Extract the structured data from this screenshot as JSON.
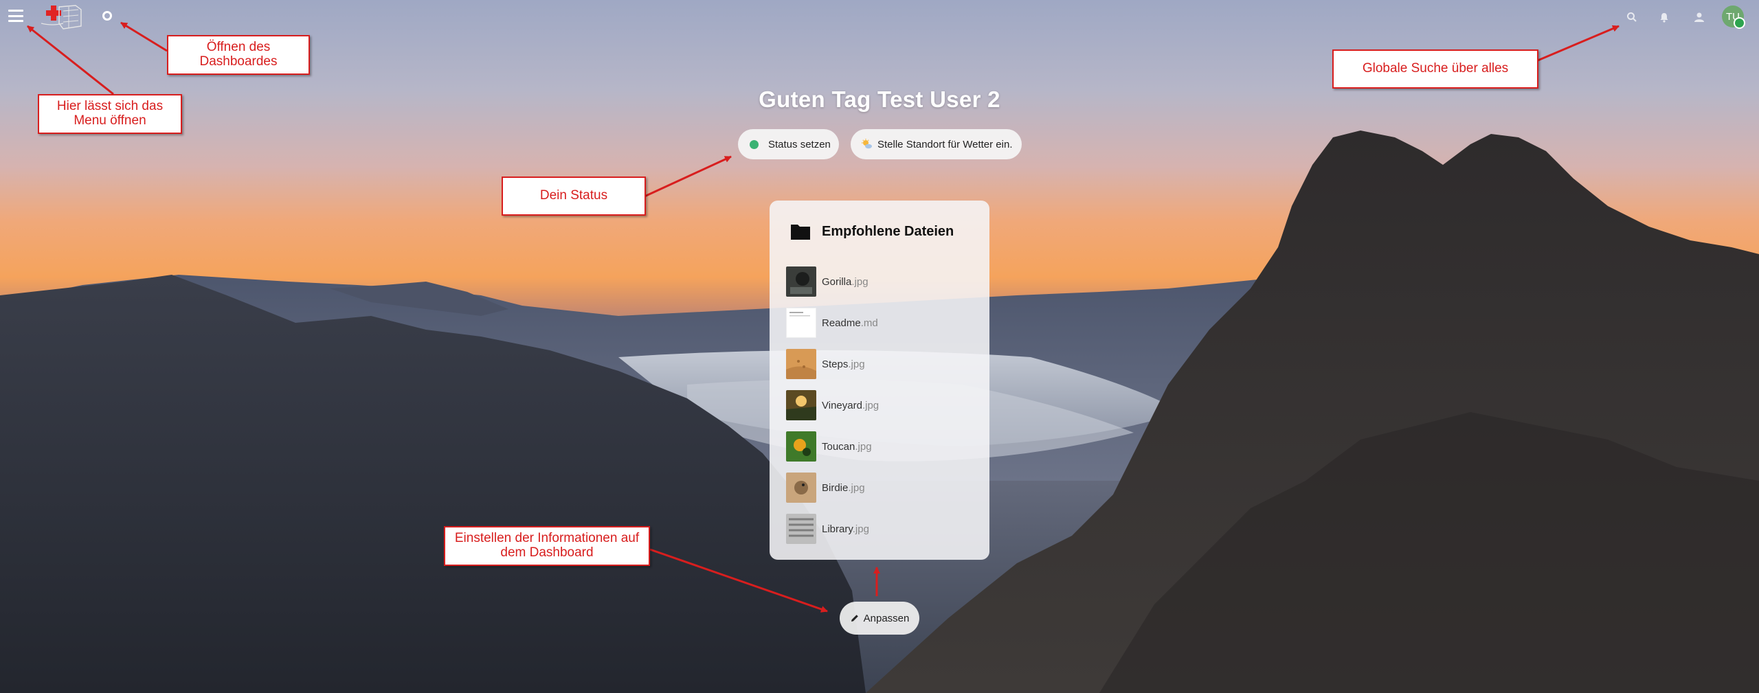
{
  "header": {
    "menu_icon": "hamburger-menu-icon",
    "logo_icon": "app-logo",
    "dashboard_icon": "dashboard-circle-icon",
    "search_icon": "search-icon",
    "notifications_icon": "bell-icon",
    "contacts_icon": "contacts-icon",
    "avatar_initials": "TU",
    "avatar_color": "#6ea86f",
    "online_status_color": "#2ea44f"
  },
  "greeting": "Guten Tag Test User 2",
  "status_button": {
    "label": "Status setzen",
    "dot_color": "#3bb273"
  },
  "weather_button": {
    "label": "Stelle Standort für Wetter ein."
  },
  "widget": {
    "title": "Empfohlene Dateien",
    "files": [
      {
        "name": "Gorilla",
        "ext": ".jpg"
      },
      {
        "name": "Readme",
        "ext": ".md"
      },
      {
        "name": "Steps",
        "ext": ".jpg"
      },
      {
        "name": "Vineyard",
        "ext": ".jpg"
      },
      {
        "name": "Toucan",
        "ext": ".jpg"
      },
      {
        "name": "Birdie",
        "ext": ".jpg"
      },
      {
        "name": "Library",
        "ext": ".jpg"
      }
    ]
  },
  "customize_button": {
    "label": "Anpassen"
  },
  "annotations": {
    "color": "#d81e1e",
    "dashboard": "Öffnen des Dashboardes",
    "menu": "Hier lässt sich das Menu öffnen",
    "search": "Globale Suche über alles",
    "status": "Dein Status",
    "customize": "Einstellen der Informationen auf dem Dashboard"
  }
}
